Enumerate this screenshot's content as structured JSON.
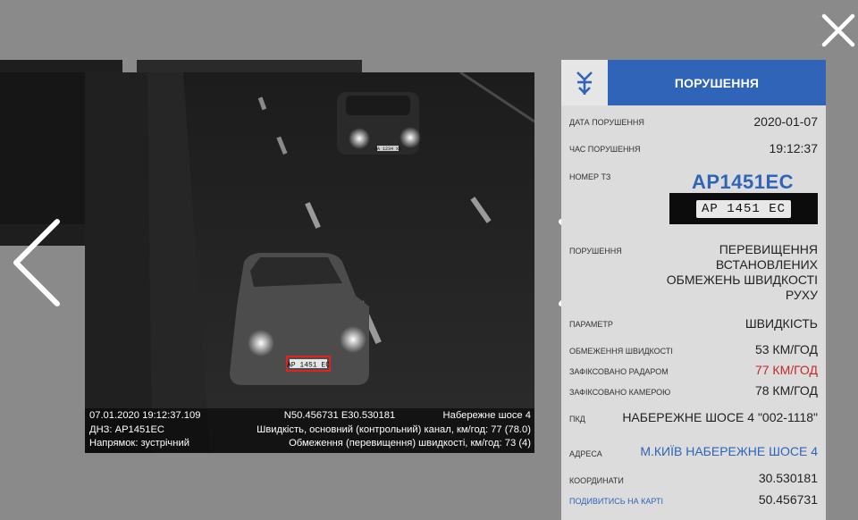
{
  "caption": {
    "datetime": "07.01.2020 19:12:37.109",
    "coords": "N50.456731 E30.530181",
    "location": "Набережне шосе 4",
    "dnz": "ДНЗ: AP1451EC",
    "speed_main": "Швидкість, основний (контрольний) канал, км/год: 77 (78.0)",
    "direction": "Напрямок: зустрічний",
    "limit_info": "Обмеження (перевищення) швидкості, км/год: 73 (4)"
  },
  "scene": {
    "front_plate": "AP 1451 EC",
    "rear_plate": "AA 1234 XX"
  },
  "panel": {
    "tab_label": "ПОРУШЕННЯ",
    "date_label": "ДАТА ПОРУШЕННЯ",
    "date_value": "2020-01-07",
    "time_label": "ЧАС ПОРУШЕННЯ",
    "time_value": "19:12:37",
    "plate_label": "НОМЕР ТЗ",
    "plate_value": "AP1451EC",
    "plate_image_text": "AP 1451 EC",
    "violation_label": "ПОРУШЕННЯ",
    "violation_value": "ПЕРЕВИЩЕННЯ ВСТАНОВЛЕНИХ ОБМЕЖЕНЬ ШВИДКОСТІ РУХУ",
    "param_label": "ПАРАМЕТР",
    "param_value": "ШВИДКІСТЬ",
    "limit_label": "ОБМЕЖЕННЯ ШВИДКОСТІ",
    "limit_value": "53 КМ/ГОД",
    "radar_label": "ЗАФІКСОВАНО РАДАРОМ",
    "radar_value": "77 КМ/ГОД",
    "camera_label": "ЗАФІКСОВАНО КАМЕРОЮ",
    "camera_value": "78 КМ/ГОД",
    "pkd_label": "ПКД",
    "pkd_value": "НАБЕРЕЖНЕ ШОСЕ 4 \"002-1118\"",
    "address_label": "АДРЕСА",
    "address_value": "М.КИЇВ НАБЕРЕЖНЕ ШОСЕ 4",
    "coords_label": "КООРДИНАТИ",
    "coords_lon": "30.530181",
    "map_link": "ПОДИВИТИСЬ НА КАРТІ",
    "coords_lat": "50.456731"
  },
  "colors": {
    "accent": "#2f64b8",
    "alert": "#c62828",
    "overlay": "#8a8a8a"
  },
  "icons": {
    "close": "close-icon",
    "prev": "chevron-left-icon",
    "next": "chevron-right-icon",
    "logo": "brand-logo-icon"
  }
}
